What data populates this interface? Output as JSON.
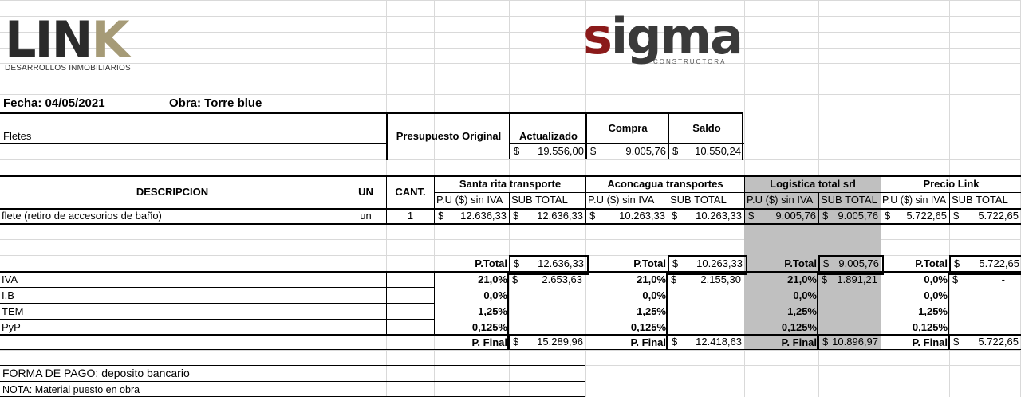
{
  "logos": {
    "link_main": "LIN",
    "link_k": "K",
    "link_sub": "DESARROLLOS INMOBILIARIOS",
    "sigma_s": "s",
    "sigma_rest": "igma",
    "sigma_sub": "CONSTRUCTORA",
    "link_color": "#2b2b2b",
    "link_accent": "#a69b77",
    "sigma_accent": "#8b1a1a"
  },
  "header": {
    "fecha": "Fecha: 04/05/2021",
    "obra": "Obra:  Torre blue"
  },
  "budget": {
    "label": "Fletes",
    "col_original": "Presupuesto Original",
    "col_actualizado": "Actualizado",
    "col_compra": "Compra",
    "col_saldo": "Saldo",
    "actualizado": {
      "cur": "$",
      "amt": "19.556,00"
    },
    "compra": {
      "cur": "$",
      "amt": "9.005,76"
    },
    "saldo": {
      "cur": "$",
      "amt": "10.550,24"
    }
  },
  "table": {
    "descripcion": "DESCRIPCION",
    "un": "UN",
    "cant": "CANT.",
    "pu_label": "P.U ($) sin IVA",
    "sub_label": "SUB TOTAL",
    "providers": [
      "Santa rita transporte",
      "Aconcagua transportes",
      "Logistica total srl",
      "Precio Link"
    ],
    "row": {
      "desc": "flete (retiro de accesorios de baño)",
      "un": "un",
      "cant": "1",
      "values": [
        {
          "cur": "$",
          "pu": "12.636,33",
          "sub": "12.636,33"
        },
        {
          "cur": "$",
          "pu": "10.263,33",
          "sub": "10.263,33"
        },
        {
          "cur": "$",
          "pu": "9.005,76",
          "sub": "9.005,76"
        },
        {
          "cur": "$",
          "pu": "5.722,65",
          "sub": "5.722,65"
        }
      ]
    },
    "highlight_color": "#c0c0c0"
  },
  "totals": {
    "ptotal_label": "P.Total",
    "pfinal_label": "P. Final",
    "row_labels": [
      "IVA",
      "I.B",
      "TEM",
      "PyP"
    ],
    "providers": [
      {
        "ptotal": "12.636,33",
        "pcts": [
          "21,0%",
          "0,0%",
          "1,25%",
          "0,125%"
        ],
        "iva_amt": "2.653,63",
        "pfinal": "15.289,96"
      },
      {
        "ptotal": "10.263,33",
        "pcts": [
          "21,0%",
          "0,0%",
          "1,25%",
          "0,125%"
        ],
        "iva_amt": "2.155,30",
        "pfinal": "12.418,63"
      },
      {
        "ptotal": "9.005,76",
        "pcts": [
          "21,0%",
          "0,0%",
          "1,25%",
          "0,125%"
        ],
        "iva_amt": "1.891,21",
        "pfinal": "10.896,97"
      },
      {
        "ptotal": "5.722,65",
        "pcts": [
          "0,0%",
          "0,0%",
          "1,25%",
          "0,125%"
        ],
        "iva_amt": "-",
        "pfinal": "5.722,65"
      }
    ]
  },
  "footer": {
    "forma_pago": "FORMA DE PAGO: deposito bancario",
    "nota": "NOTA: Material puesto en obra"
  }
}
